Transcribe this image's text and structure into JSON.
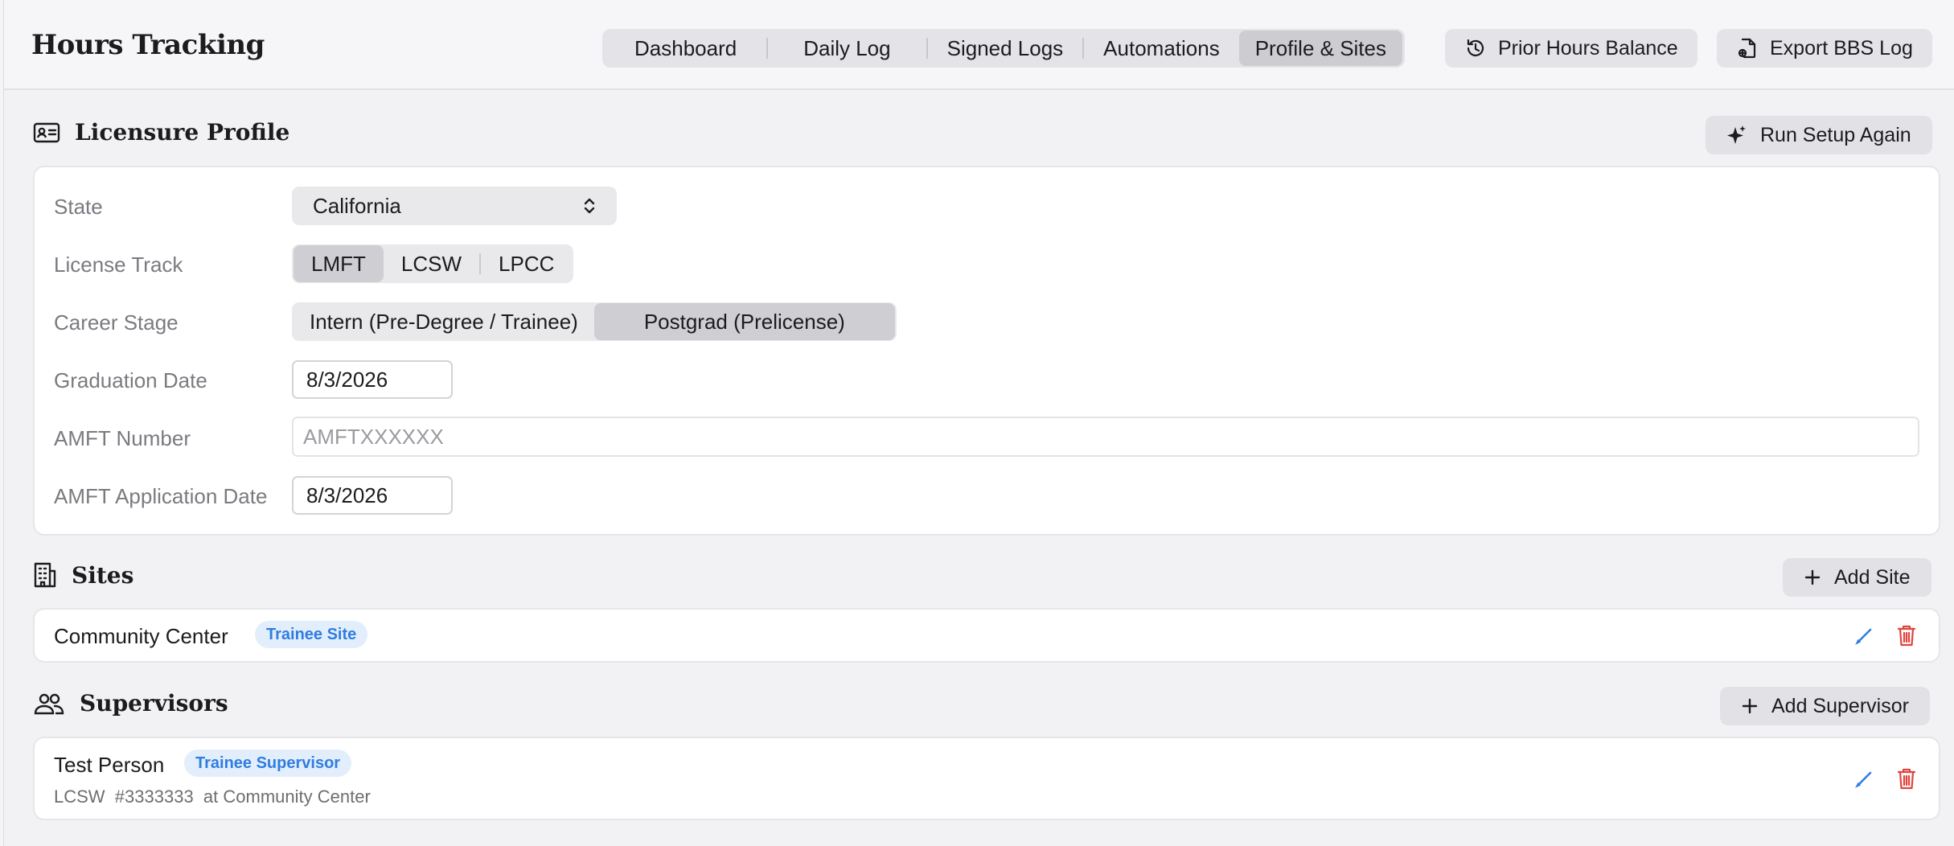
{
  "header": {
    "title": "Hours Tracking",
    "tabs": [
      {
        "label": "Dashboard"
      },
      {
        "label": "Daily Log"
      },
      {
        "label": "Signed Logs"
      },
      {
        "label": "Automations"
      },
      {
        "label": "Profile & Sites"
      }
    ],
    "active_tab": "Profile & Sites",
    "prior_hours_label": "Prior Hours Balance",
    "export_label": "Export BBS Log"
  },
  "profile": {
    "heading": "Licensure Profile",
    "run_setup_label": "Run Setup Again",
    "state_label": "State",
    "state_value": "California",
    "license_track_label": "License Track",
    "license_tracks": [
      {
        "label": "LMFT"
      },
      {
        "label": "LCSW"
      },
      {
        "label": "LPCC"
      }
    ],
    "license_track_selected": "LMFT",
    "career_stage_label": "Career Stage",
    "career_stages": [
      {
        "label": "Intern (Pre-Degree / Trainee)"
      },
      {
        "label": "Postgrad (Prelicense)"
      }
    ],
    "career_stage_selected": "Postgrad (Prelicense)",
    "graduation_date_label": "Graduation Date",
    "graduation_date": "8/3/2026",
    "amft_number_label": "AMFT Number",
    "amft_number_value": "",
    "amft_number_placeholder": "AMFTXXXXXX",
    "amft_application_date_label": "AMFT Application Date",
    "amft_application_date": "8/3/2026"
  },
  "sites": {
    "heading": "Sites",
    "add_label": "Add Site",
    "items": [
      {
        "name": "Community Center",
        "badge": "Trainee Site"
      }
    ]
  },
  "supervisors": {
    "heading": "Supervisors",
    "add_label": "Add Supervisor",
    "items": [
      {
        "name": "Test Person",
        "badge": "Trainee Supervisor",
        "license": "LCSW",
        "number": "#3333333",
        "site": "at Community Center"
      }
    ]
  },
  "colors": {
    "badge_text": "#2f7de1",
    "badge_bg": "#e3eefc",
    "edit_icon": "#2f7de1",
    "delete_icon": "#e0443e"
  },
  "icons": {
    "prior_hours": "history-clock-icon",
    "export": "document-export-icon",
    "profile": "id-card-icon",
    "run_setup": "sparkle-icon",
    "sites": "building-icon",
    "supervisors": "people-icon",
    "add": "plus-icon",
    "edit": "pencil-icon",
    "delete": "trash-icon",
    "select": "chevron-up-down-icon"
  }
}
